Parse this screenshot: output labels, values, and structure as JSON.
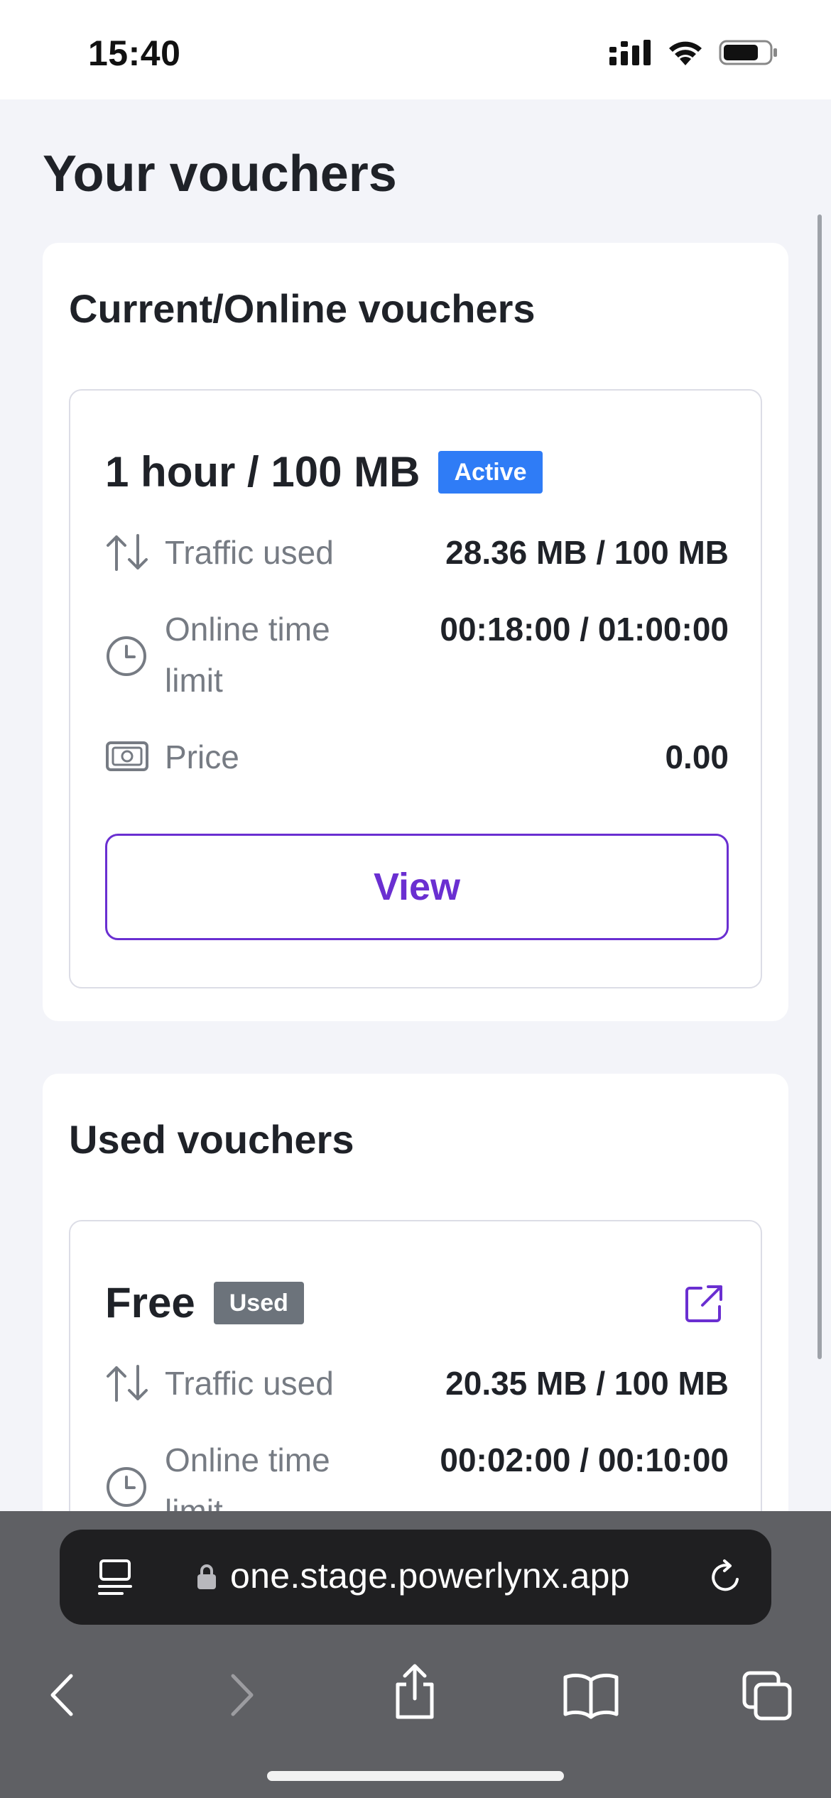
{
  "status_bar": {
    "time": "15:40"
  },
  "page": {
    "title": "Your vouchers"
  },
  "current_section": {
    "title": "Current/Online vouchers",
    "voucher": {
      "name": "1 hour / 100 MB",
      "badge": "Active",
      "rows": [
        {
          "label": "Traffic used",
          "value": "28.36 MB / 100 MB",
          "icon": "arrows-up-down-icon"
        },
        {
          "label": "Online time limit",
          "value": "00:18:00 / 01:00:00",
          "icon": "clock-icon"
        },
        {
          "label": "Price",
          "value": "0.00",
          "icon": "cash-icon"
        }
      ],
      "button_label": "View"
    }
  },
  "used_section": {
    "title": "Used vouchers",
    "voucher": {
      "name": "Free",
      "badge": "Used",
      "rows": [
        {
          "label": "Traffic used",
          "value": "20.35 MB / 100 MB",
          "icon": "arrows-up-down-icon"
        },
        {
          "label": "Online time limit",
          "value": "00:02:00 / 00:10:00",
          "icon": "clock-icon"
        }
      ]
    }
  },
  "browser": {
    "url": "one.stage.powerlynx.app"
  },
  "colors": {
    "accent": "#6a2fd1",
    "active_badge": "#2f7cf6",
    "used_badge": "#6c737b"
  }
}
